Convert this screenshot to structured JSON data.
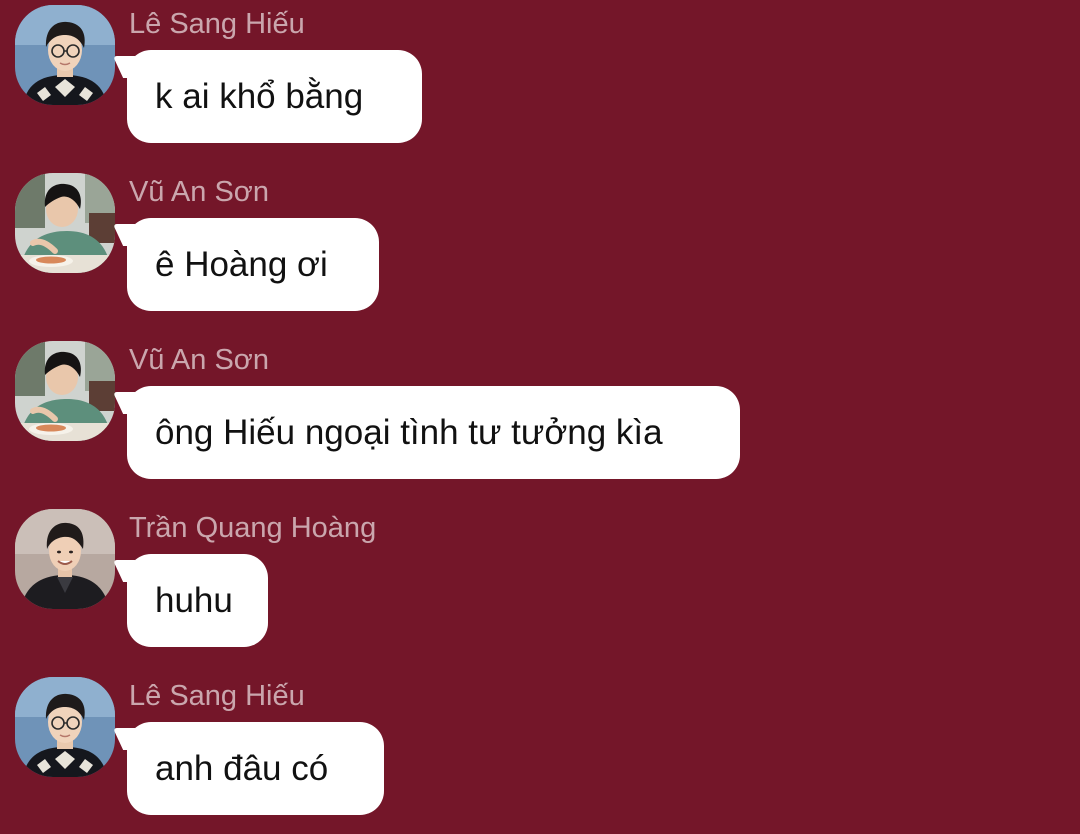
{
  "colors": {
    "background": "#741629",
    "bubble": "#ffffff",
    "sender_name": "#c79aa3",
    "message_text": "#111111"
  },
  "messages": [
    {
      "sender": "Lê Sang Hiếu",
      "text": "k ai khổ bằng",
      "avatar": "avatar-le-sang-hieu"
    },
    {
      "sender": "Vũ An Sơn",
      "text": "ê Hoàng ơi",
      "avatar": "avatar-vu-an-son"
    },
    {
      "sender": "Vũ An Sơn",
      "text": "ông Hiếu ngoại tình tư tưởng kìa",
      "avatar": "avatar-vu-an-son"
    },
    {
      "sender": "Trần Quang Hoàng",
      "text": "huhu",
      "avatar": "avatar-tran-quang-hoang"
    },
    {
      "sender": "Lê Sang Hiếu",
      "text": "anh đâu có",
      "avatar": "avatar-le-sang-hieu"
    }
  ]
}
